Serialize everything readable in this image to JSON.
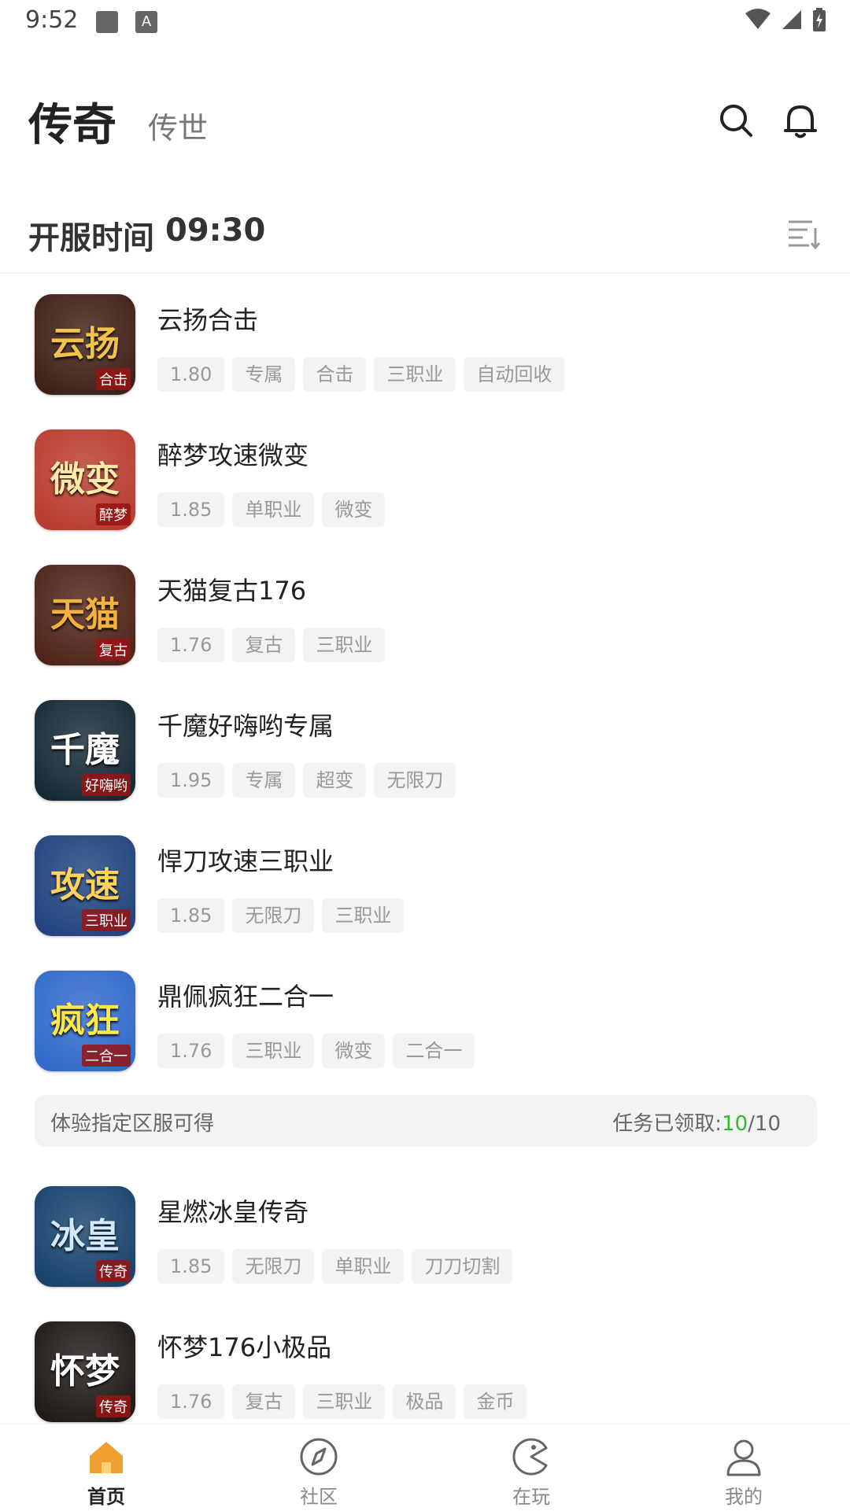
{
  "status_bar": {
    "time": "9:52"
  },
  "header": {
    "tab_active": "传奇",
    "tab_other": "传世"
  },
  "section": {
    "title": "开服时间",
    "time": "09:30"
  },
  "games": [
    {
      "name": "云扬合击",
      "tags": [
        "1.80",
        "专属",
        "合击",
        "三职业",
        "自动回收"
      ],
      "icon_text": "云扬",
      "icon_small": "合击",
      "icon_bg": "#3a1a10",
      "icon_color": "#f2c24a"
    },
    {
      "name": "醉梦攻速微变",
      "tags": [
        "1.85",
        "单职业",
        "微变"
      ],
      "icon_text": "微变",
      "icon_small": "醉梦",
      "icon_bg": "#b8372a",
      "icon_color": "#ffe9a8"
    },
    {
      "name": "天猫复古176",
      "tags": [
        "1.76",
        "复古",
        "三职业"
      ],
      "icon_text": "天猫",
      "icon_small": "复古",
      "icon_bg": "#4a1e12",
      "icon_color": "#f4b23c"
    },
    {
      "name": "千魔好嗨哟专属",
      "tags": [
        "1.95",
        "专属",
        "超变",
        "无限刀"
      ],
      "icon_text": "千魔",
      "icon_small": "好嗨哟",
      "icon_bg": "#0f2430",
      "icon_color": "#ffffff"
    },
    {
      "name": "悍刀攻速三职业",
      "tags": [
        "1.85",
        "无限刀",
        "三职业"
      ],
      "icon_text": "攻速",
      "icon_small": "三职业",
      "icon_bg": "#1b3f7a",
      "icon_color": "#ffd35a"
    },
    {
      "name": "鼎佩疯狂二合一",
      "tags": [
        "1.76",
        "三职业",
        "微变",
        "二合一"
      ],
      "icon_text": "疯狂",
      "icon_small": "二合一",
      "icon_bg": "#2b66c9",
      "icon_color": "#ffe94a"
    },
    {
      "name": "星燃冰皇传奇",
      "tags": [
        "1.85",
        "无限刀",
        "单职业",
        "刀刀切割"
      ],
      "icon_text": "冰皇",
      "icon_small": "传奇",
      "icon_bg": "#123e69",
      "icon_color": "#cfe9ff"
    },
    {
      "name": "怀梦176小极品",
      "tags": [
        "1.76",
        "复古",
        "三职业",
        "极品",
        "金币"
      ],
      "icon_text": "怀梦",
      "icon_small": "传奇",
      "icon_bg": "#1a1410",
      "icon_color": "#ffffff"
    }
  ],
  "task": {
    "label": "体验指定区服可得",
    "prefix": "任务已领取:",
    "done": "10",
    "total": "/10"
  },
  "nav": [
    {
      "label": "首页",
      "icon": "home-icon",
      "active": true
    },
    {
      "label": "社区",
      "icon": "compass-icon",
      "active": false
    },
    {
      "label": "在玩",
      "icon": "pacman-icon",
      "active": false
    },
    {
      "label": "我的",
      "icon": "user-icon",
      "active": false
    }
  ],
  "colors": {
    "accent": "#f0a030",
    "task_done": "#2eb82e"
  }
}
